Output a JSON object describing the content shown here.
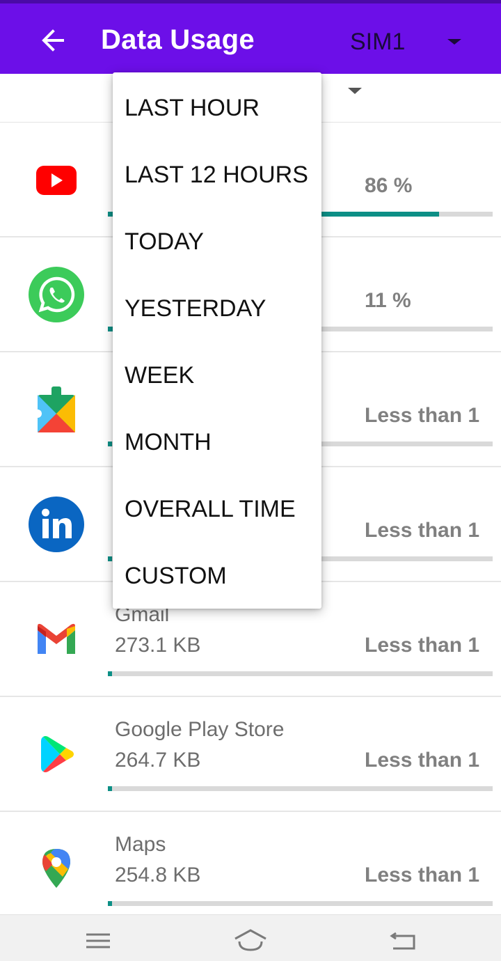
{
  "header": {
    "title": "Data Usage",
    "sim_label": "SIM1",
    "back_icon": "arrow-left-icon",
    "sim_dropdown_icon": "caret-down-icon",
    "bg_color": "#6c0fe8"
  },
  "period_menu": {
    "items": [
      "LAST HOUR",
      "LAST 12 HOURS",
      "TODAY",
      "YESTERDAY",
      "WEEK",
      "MONTH",
      "OVERALL TIME",
      "CUSTOM"
    ]
  },
  "apps": [
    {
      "icon": "youtube-icon",
      "name": "",
      "size": "",
      "percent_label": "86 %",
      "usage_fraction": 0.86
    },
    {
      "icon": "whatsapp-icon",
      "name": "",
      "size": "",
      "percent_label": "11 %",
      "usage_fraction": 0.11
    },
    {
      "icon": "google-play-services-icon",
      "name": "",
      "size": "",
      "percent_label": "Less than 1",
      "usage_fraction": 0.005
    },
    {
      "icon": "linkedin-icon",
      "name": "",
      "size": "",
      "percent_label": "Less than 1",
      "usage_fraction": 0.005
    },
    {
      "icon": "gmail-icon",
      "name": "Gmail",
      "size": "273.1 KB",
      "percent_label": "Less than 1",
      "usage_fraction": 0.005
    },
    {
      "icon": "google-play-store-icon",
      "name": "Google Play Store",
      "size": "264.7 KB",
      "percent_label": "Less than 1",
      "usage_fraction": 0.005
    },
    {
      "icon": "google-maps-icon",
      "name": "Maps",
      "size": "254.8 KB",
      "percent_label": "Less than 1",
      "usage_fraction": 0.005
    }
  ],
  "progress_color": "#0d8f86",
  "navbar": {
    "menu_icon": "menu-icon",
    "home_icon": "home-icon",
    "back_icon": "back-icon"
  }
}
